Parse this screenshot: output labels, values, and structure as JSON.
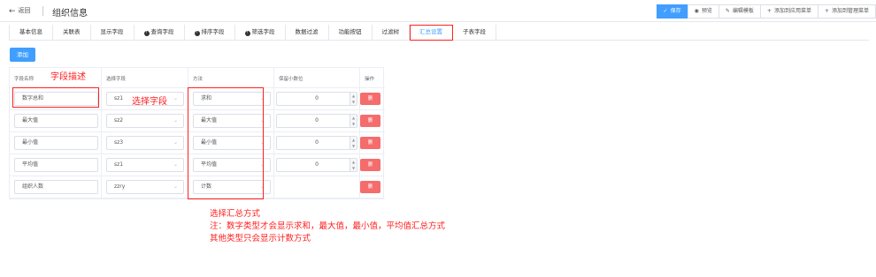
{
  "header": {
    "back_label": "返回",
    "title": "组织信息",
    "actions": [
      {
        "icon": "check-icon",
        "glyph": "✓",
        "label": "保存"
      },
      {
        "icon": "eye-icon",
        "glyph": "◉",
        "label": "预览"
      },
      {
        "icon": "edit-icon",
        "glyph": "✎",
        "label": "编辑模板"
      },
      {
        "icon": "plus-icon",
        "glyph": "+",
        "label": "添加到应用菜单"
      },
      {
        "icon": "plus-icon",
        "glyph": "+",
        "label": "添加到管理菜单"
      }
    ]
  },
  "tabs": [
    {
      "label": "基本信息",
      "info": false
    },
    {
      "label": "关联表",
      "info": false
    },
    {
      "label": "显示字段",
      "info": false
    },
    {
      "label": "查询字段",
      "info": true
    },
    {
      "label": "排序字段",
      "info": true
    },
    {
      "label": "筛选字段",
      "info": true
    },
    {
      "label": "数据过滤",
      "info": false
    },
    {
      "label": "功能按钮",
      "info": false
    },
    {
      "label": "过滤树",
      "info": false
    },
    {
      "label": "汇总设置",
      "info": false,
      "active": true
    },
    {
      "label": "子表字段",
      "info": false
    }
  ],
  "add_label": "添加",
  "table": {
    "headers": [
      "字段名称",
      "选择字段",
      "方法",
      "保留小数位",
      "操作"
    ],
    "rows": [
      {
        "name": "数字总和",
        "field": "sz1",
        "method": "求和",
        "decimals": "0",
        "delete": "删"
      },
      {
        "name": "最大值",
        "field": "sz2",
        "method": "最大值",
        "decimals": "0",
        "delete": "删"
      },
      {
        "name": "最小值",
        "field": "sz3",
        "method": "最小值",
        "decimals": "0",
        "delete": "删"
      },
      {
        "name": "平均值",
        "field": "sz1",
        "method": "平均值",
        "decimals": "0",
        "delete": "删"
      },
      {
        "name": "组织人数",
        "field": "zzry",
        "method": "计数",
        "decimals": "",
        "delete": "删"
      }
    ]
  },
  "annotations": {
    "field_desc": "字段描述",
    "select_field": "选择字段",
    "summary_line1": "选择汇总方式",
    "summary_line2": "注：数字类型才会显示求和，最大值，最小值，平均值汇总方式",
    "summary_line3": "其他类型只会显示计数方式"
  },
  "colors": {
    "primary": "#409eff",
    "danger": "#f56c6c",
    "annotation": "#ff2020"
  }
}
